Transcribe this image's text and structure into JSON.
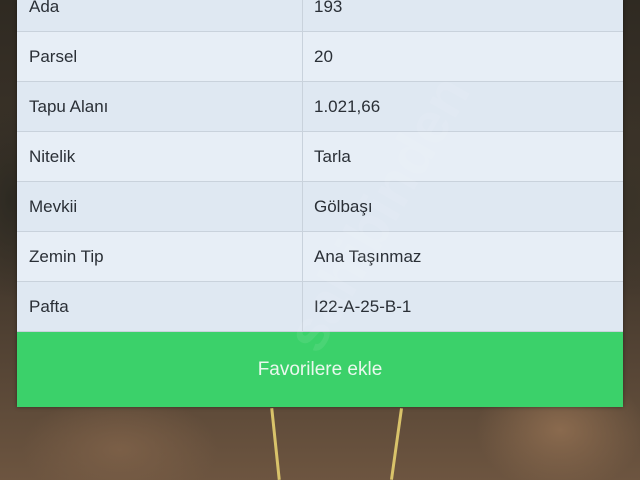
{
  "details": {
    "rows": [
      {
        "label": "Ada",
        "value": "193"
      },
      {
        "label": "Parsel",
        "value": "20"
      },
      {
        "label": "Tapu Alanı",
        "value": "1.021,66"
      },
      {
        "label": "Nitelik",
        "value": "Tarla"
      },
      {
        "label": "Mevkii",
        "value": "Gölbaşı"
      },
      {
        "label": "Zemin Tip",
        "value": "Ana Taşınmaz"
      },
      {
        "label": "Pafta",
        "value": "I22-A-25-B-1"
      }
    ]
  },
  "actions": {
    "favorite_label": "Favorilere ekle"
  },
  "colors": {
    "button_green": "#3bd16a",
    "row_bg": "#e4ecf4",
    "text": "#2a2f36"
  }
}
